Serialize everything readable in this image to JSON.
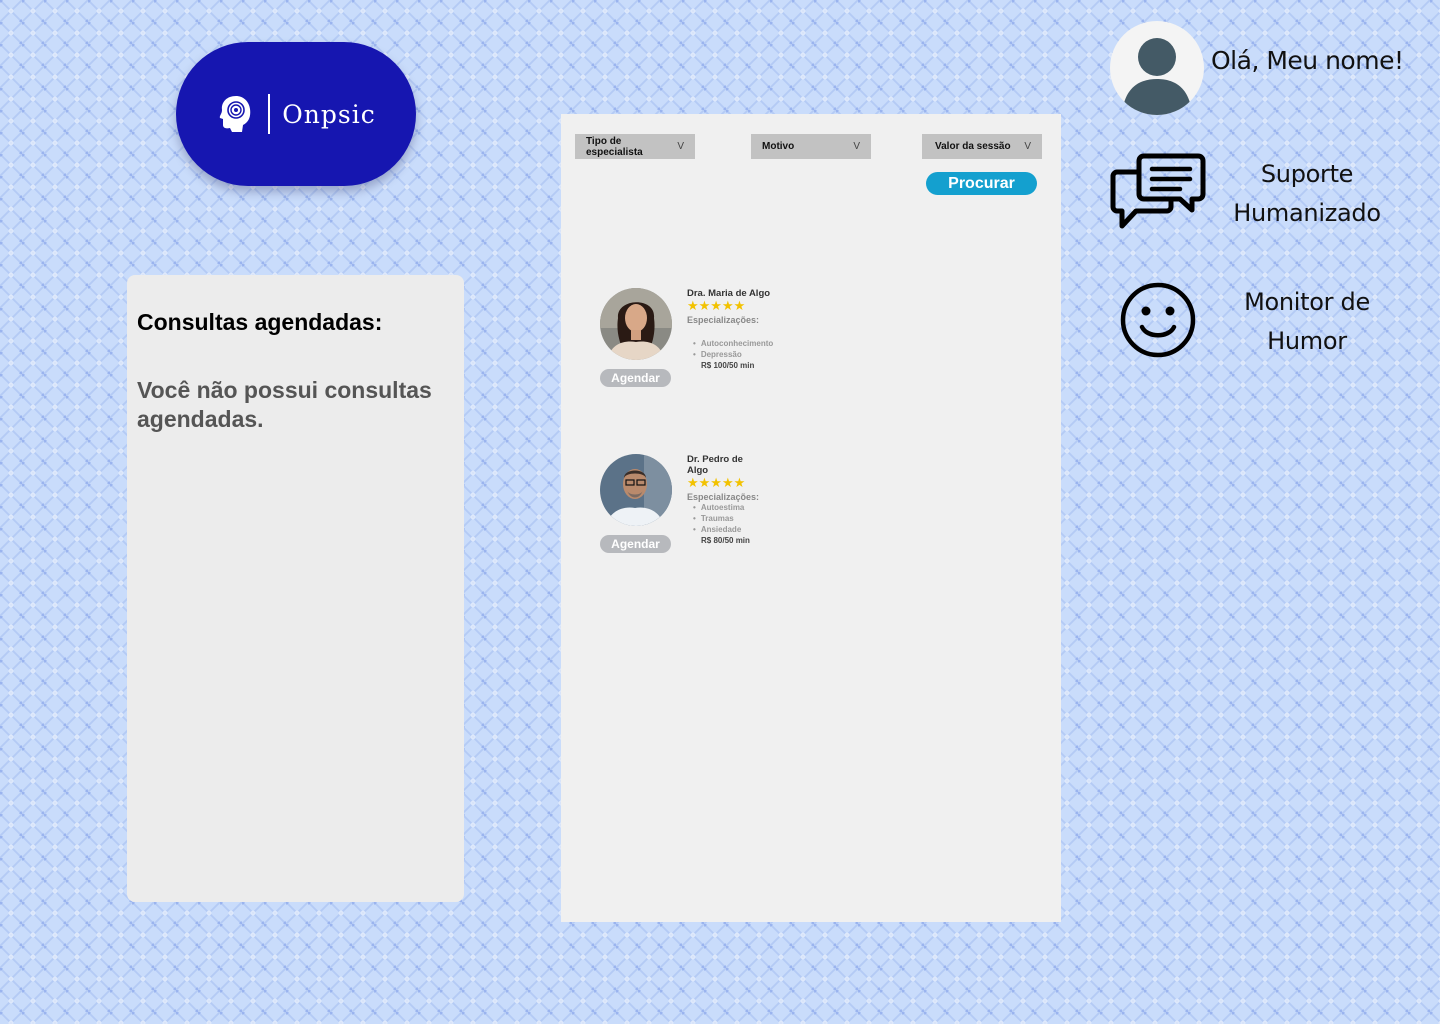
{
  "logo": {
    "text": "Onpsic"
  },
  "appointments": {
    "title": "Consultas agendadas:",
    "empty_message": "Você não possui consultas agendadas."
  },
  "filters": [
    {
      "label": "Tipo de especialista",
      "chevron": "V"
    },
    {
      "label": "Motivo",
      "chevron": "V"
    },
    {
      "label": "Valor da sessão",
      "chevron": "V"
    }
  ],
  "search_button": "Procurar",
  "specialists": [
    {
      "name": "Dra. Maria de Algo",
      "stars": "★★★★★",
      "rating": 5,
      "spec_label": "Especializações:",
      "specializations": [
        "Autoconhecimento",
        "Depressão"
      ],
      "price": "R$ 100/50 min",
      "button": "Agendar"
    },
    {
      "name": "Dr. Pedro de Algo",
      "stars": "★★★★★",
      "rating": 5,
      "spec_label": "Especializações:",
      "specializations": [
        "Autoestima",
        "Traumas",
        "Ansiedade"
      ],
      "price": "R$ 80/50 min",
      "button": "Agendar"
    }
  ],
  "user": {
    "greeting": "Olá, Meu nome!"
  },
  "sidebar": {
    "support": {
      "line1": "Suporte",
      "line2": "Humanizado",
      "icon": "chat-bubbles-icon"
    },
    "mood": {
      "line1": "Monitor de",
      "line2": "Humor",
      "icon": "smiley-icon"
    }
  },
  "colors": {
    "brand": "#1616b0",
    "accent": "#14a0cf",
    "star": "#f2c200"
  }
}
